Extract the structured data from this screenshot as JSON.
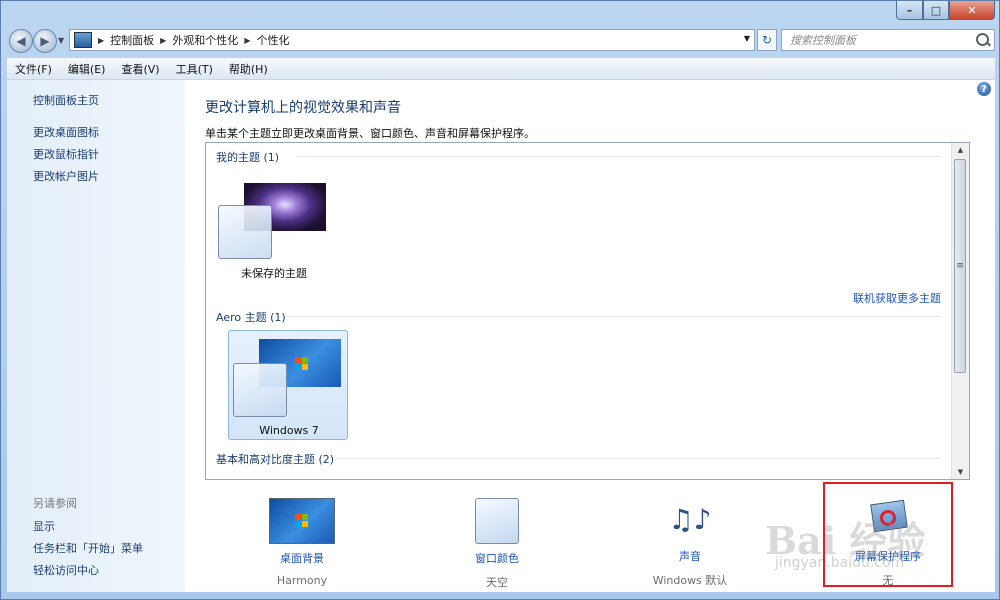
{
  "window": {
    "caption_buttons": {
      "minimize": "–",
      "maximize": "□",
      "close": "✕"
    }
  },
  "navbar": {
    "breadcrumbs": [
      "控制面板",
      "外观和个性化",
      "个性化"
    ],
    "search_placeholder": "搜索控制面板"
  },
  "menubar": {
    "items": [
      "文件(F)",
      "编辑(E)",
      "查看(V)",
      "工具(T)",
      "帮助(H)"
    ]
  },
  "sidebar": {
    "home_link": "控制面板主页",
    "links": [
      "更改桌面图标",
      "更改鼠标指针",
      "更改帐户图片"
    ],
    "see_also_title": "另请参阅",
    "see_also_links": [
      "显示",
      "任务栏和「开始」菜单",
      "轻松访问中心"
    ]
  },
  "main": {
    "title": "更改计算机上的视觉效果和声音",
    "description": "单击某个主题立即更改桌面背景、窗口颜色、声音和屏幕保护程序。",
    "groups": {
      "my_themes": {
        "heading": "我的主题 (1)",
        "themes": [
          "未保存的主题"
        ]
      },
      "online_link": "联机获取更多主题",
      "aero_themes": {
        "heading": "Aero 主题 (1)",
        "themes": [
          "Windows 7"
        ]
      },
      "basic_themes": {
        "heading": "基本和高对比度主题 (2)"
      }
    },
    "settings": [
      {
        "label": "桌面背景",
        "value": "Harmony",
        "icon": "desktop-background-icon"
      },
      {
        "label": "窗口颜色",
        "value": "天空",
        "icon": "window-color-icon"
      },
      {
        "label": "声音",
        "value": "Windows 默认",
        "icon": "sounds-icon"
      },
      {
        "label": "屏幕保护程序",
        "value": "无",
        "icon": "screen-saver-icon"
      }
    ]
  },
  "watermark": {
    "text": "Bai 经验",
    "sub": "jingyan.baidu.com"
  },
  "colors": {
    "link": "#1f55b4",
    "title": "#1a3b73",
    "highlight": "#e02020"
  }
}
